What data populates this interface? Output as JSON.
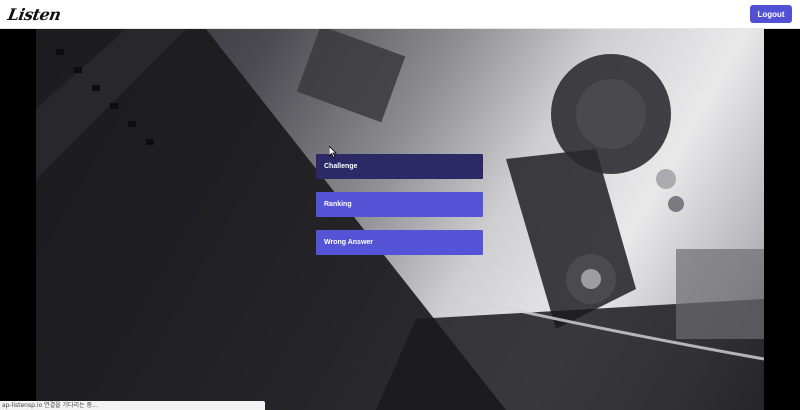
{
  "header": {
    "logo_text": "Listen",
    "logout_label": "Logout",
    "accent_color": "#5250d4"
  },
  "menu": {
    "items": [
      {
        "label": "Challenge",
        "state": "active",
        "color": "#2b2a66"
      },
      {
        "label": "Ranking",
        "state": "normal",
        "color": "#5553d6"
      },
      {
        "label": "Wrong Answer",
        "state": "normal",
        "color": "#5553d6"
      }
    ]
  },
  "background": {
    "image": "grayscale close-up of film projector reels and film strip"
  },
  "statusbar": {
    "text": "ap-listensp.io 연결을 기다리는 중..."
  }
}
